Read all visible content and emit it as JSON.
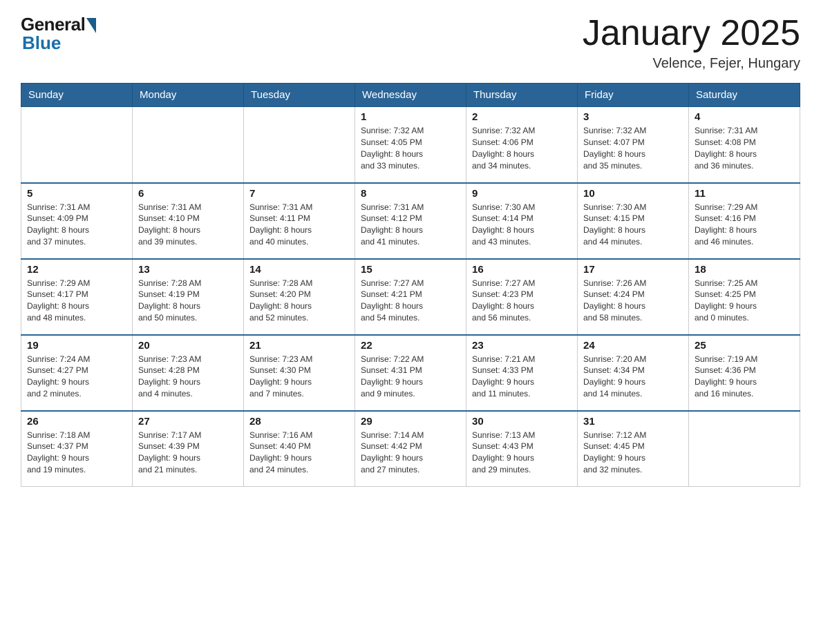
{
  "header": {
    "logo_general": "General",
    "logo_blue": "Blue",
    "title": "January 2025",
    "location": "Velence, Fejer, Hungary"
  },
  "weekdays": [
    "Sunday",
    "Monday",
    "Tuesday",
    "Wednesday",
    "Thursday",
    "Friday",
    "Saturday"
  ],
  "weeks": [
    [
      {
        "day": "",
        "info": ""
      },
      {
        "day": "",
        "info": ""
      },
      {
        "day": "",
        "info": ""
      },
      {
        "day": "1",
        "info": "Sunrise: 7:32 AM\nSunset: 4:05 PM\nDaylight: 8 hours\nand 33 minutes."
      },
      {
        "day": "2",
        "info": "Sunrise: 7:32 AM\nSunset: 4:06 PM\nDaylight: 8 hours\nand 34 minutes."
      },
      {
        "day": "3",
        "info": "Sunrise: 7:32 AM\nSunset: 4:07 PM\nDaylight: 8 hours\nand 35 minutes."
      },
      {
        "day": "4",
        "info": "Sunrise: 7:31 AM\nSunset: 4:08 PM\nDaylight: 8 hours\nand 36 minutes."
      }
    ],
    [
      {
        "day": "5",
        "info": "Sunrise: 7:31 AM\nSunset: 4:09 PM\nDaylight: 8 hours\nand 37 minutes."
      },
      {
        "day": "6",
        "info": "Sunrise: 7:31 AM\nSunset: 4:10 PM\nDaylight: 8 hours\nand 39 minutes."
      },
      {
        "day": "7",
        "info": "Sunrise: 7:31 AM\nSunset: 4:11 PM\nDaylight: 8 hours\nand 40 minutes."
      },
      {
        "day": "8",
        "info": "Sunrise: 7:31 AM\nSunset: 4:12 PM\nDaylight: 8 hours\nand 41 minutes."
      },
      {
        "day": "9",
        "info": "Sunrise: 7:30 AM\nSunset: 4:14 PM\nDaylight: 8 hours\nand 43 minutes."
      },
      {
        "day": "10",
        "info": "Sunrise: 7:30 AM\nSunset: 4:15 PM\nDaylight: 8 hours\nand 44 minutes."
      },
      {
        "day": "11",
        "info": "Sunrise: 7:29 AM\nSunset: 4:16 PM\nDaylight: 8 hours\nand 46 minutes."
      }
    ],
    [
      {
        "day": "12",
        "info": "Sunrise: 7:29 AM\nSunset: 4:17 PM\nDaylight: 8 hours\nand 48 minutes."
      },
      {
        "day": "13",
        "info": "Sunrise: 7:28 AM\nSunset: 4:19 PM\nDaylight: 8 hours\nand 50 minutes."
      },
      {
        "day": "14",
        "info": "Sunrise: 7:28 AM\nSunset: 4:20 PM\nDaylight: 8 hours\nand 52 minutes."
      },
      {
        "day": "15",
        "info": "Sunrise: 7:27 AM\nSunset: 4:21 PM\nDaylight: 8 hours\nand 54 minutes."
      },
      {
        "day": "16",
        "info": "Sunrise: 7:27 AM\nSunset: 4:23 PM\nDaylight: 8 hours\nand 56 minutes."
      },
      {
        "day": "17",
        "info": "Sunrise: 7:26 AM\nSunset: 4:24 PM\nDaylight: 8 hours\nand 58 minutes."
      },
      {
        "day": "18",
        "info": "Sunrise: 7:25 AM\nSunset: 4:25 PM\nDaylight: 9 hours\nand 0 minutes."
      }
    ],
    [
      {
        "day": "19",
        "info": "Sunrise: 7:24 AM\nSunset: 4:27 PM\nDaylight: 9 hours\nand 2 minutes."
      },
      {
        "day": "20",
        "info": "Sunrise: 7:23 AM\nSunset: 4:28 PM\nDaylight: 9 hours\nand 4 minutes."
      },
      {
        "day": "21",
        "info": "Sunrise: 7:23 AM\nSunset: 4:30 PM\nDaylight: 9 hours\nand 7 minutes."
      },
      {
        "day": "22",
        "info": "Sunrise: 7:22 AM\nSunset: 4:31 PM\nDaylight: 9 hours\nand 9 minutes."
      },
      {
        "day": "23",
        "info": "Sunrise: 7:21 AM\nSunset: 4:33 PM\nDaylight: 9 hours\nand 11 minutes."
      },
      {
        "day": "24",
        "info": "Sunrise: 7:20 AM\nSunset: 4:34 PM\nDaylight: 9 hours\nand 14 minutes."
      },
      {
        "day": "25",
        "info": "Sunrise: 7:19 AM\nSunset: 4:36 PM\nDaylight: 9 hours\nand 16 minutes."
      }
    ],
    [
      {
        "day": "26",
        "info": "Sunrise: 7:18 AM\nSunset: 4:37 PM\nDaylight: 9 hours\nand 19 minutes."
      },
      {
        "day": "27",
        "info": "Sunrise: 7:17 AM\nSunset: 4:39 PM\nDaylight: 9 hours\nand 21 minutes."
      },
      {
        "day": "28",
        "info": "Sunrise: 7:16 AM\nSunset: 4:40 PM\nDaylight: 9 hours\nand 24 minutes."
      },
      {
        "day": "29",
        "info": "Sunrise: 7:14 AM\nSunset: 4:42 PM\nDaylight: 9 hours\nand 27 minutes."
      },
      {
        "day": "30",
        "info": "Sunrise: 7:13 AM\nSunset: 4:43 PM\nDaylight: 9 hours\nand 29 minutes."
      },
      {
        "day": "31",
        "info": "Sunrise: 7:12 AM\nSunset: 4:45 PM\nDaylight: 9 hours\nand 32 minutes."
      },
      {
        "day": "",
        "info": ""
      }
    ]
  ]
}
